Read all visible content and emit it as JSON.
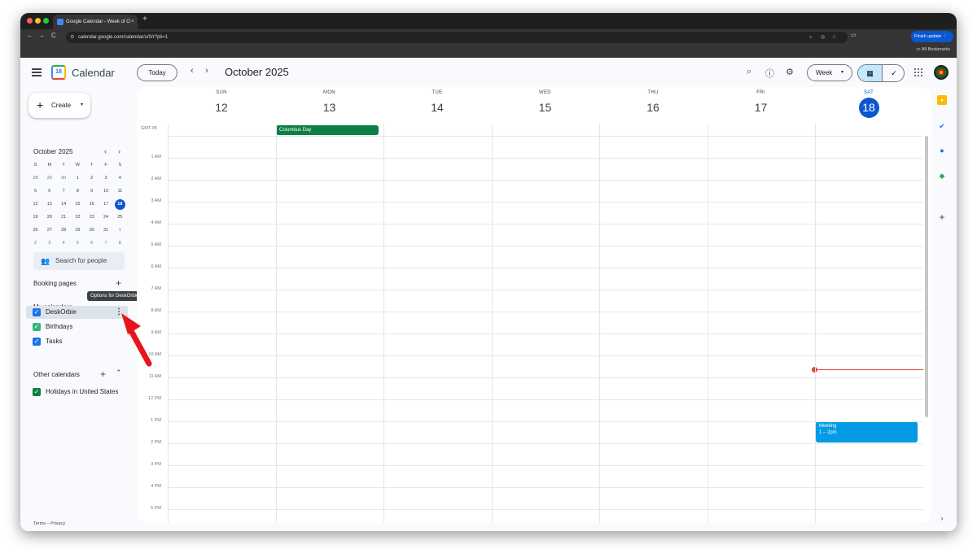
{
  "browser": {
    "tab_title": "Google Calendar - Week of O",
    "tab_close": "×",
    "new_tab": "+",
    "back": "←",
    "forward": "→",
    "reload": "C",
    "url": "calendar.google.com/calendar/u/0/r?pli=1",
    "finish_update": "Finish update ⋮",
    "bookmarks": "All Bookmarks"
  },
  "header": {
    "app_name": "Calendar",
    "logo_text": "18",
    "today_label": "Today",
    "prev": "‹",
    "next": "›",
    "month_title": "October 2025",
    "view_label": "Week",
    "view_caret": "▾"
  },
  "sidebar": {
    "create_label": "Create",
    "mini_calendar": {
      "title": "October 2025",
      "weekdays": [
        "S",
        "M",
        "T",
        "W",
        "T",
        "F",
        "S"
      ],
      "weeks": [
        [
          "28",
          "29",
          "30",
          "1",
          "2",
          "3",
          "4"
        ],
        [
          "5",
          "6",
          "7",
          "8",
          "9",
          "10",
          "11"
        ],
        [
          "12",
          "13",
          "14",
          "15",
          "16",
          "17",
          "18"
        ],
        [
          "19",
          "20",
          "21",
          "22",
          "23",
          "24",
          "25"
        ],
        [
          "26",
          "27",
          "28",
          "29",
          "30",
          "31",
          "1"
        ],
        [
          "2",
          "3",
          "4",
          "5",
          "6",
          "7",
          "8"
        ]
      ],
      "selected": "18"
    },
    "search_people_placeholder": "Search for people",
    "booking_pages": "Booking pages",
    "my_calendars": "My calendars",
    "my_calendar_items": [
      {
        "label": "DeskOrbie",
        "color": "#1a73e8"
      },
      {
        "label": "Birthdays",
        "color": "#33b679"
      },
      {
        "label": "Tasks",
        "color": "#1a73e8"
      }
    ],
    "other_calendars": "Other calendars",
    "other_calendar_items": [
      {
        "label": "Holidays in United States",
        "color": "#0b8043"
      }
    ],
    "tooltip": "Options for DeskOrbie",
    "terms": "Terms – Privacy"
  },
  "week": {
    "timezone": "GMT-05",
    "days": [
      {
        "dow": "SUN",
        "num": "12"
      },
      {
        "dow": "MON",
        "num": "13"
      },
      {
        "dow": "TUE",
        "num": "14"
      },
      {
        "dow": "WED",
        "num": "15"
      },
      {
        "dow": "THU",
        "num": "16"
      },
      {
        "dow": "FRI",
        "num": "17"
      },
      {
        "dow": "SAT",
        "num": "18"
      }
    ],
    "today_index": 6,
    "hours": [
      "1 AM",
      "2 AM",
      "3 AM",
      "4 AM",
      "5 AM",
      "6 AM",
      "7 AM",
      "8 AM",
      "9 AM",
      "10 AM",
      "11 AM",
      "12 PM",
      "1 PM",
      "2 PM",
      "3 PM",
      "4 PM",
      "5 PM"
    ],
    "all_day_event": "Columbus Day",
    "event": {
      "title": "Meeting",
      "time": "1 – 2pm"
    }
  },
  "colors": {
    "accent": "#0b57d0",
    "holiday": "#0b8043",
    "event": "#039be5",
    "now": "#ea4335",
    "annotation_arrow": "#e8141b"
  }
}
